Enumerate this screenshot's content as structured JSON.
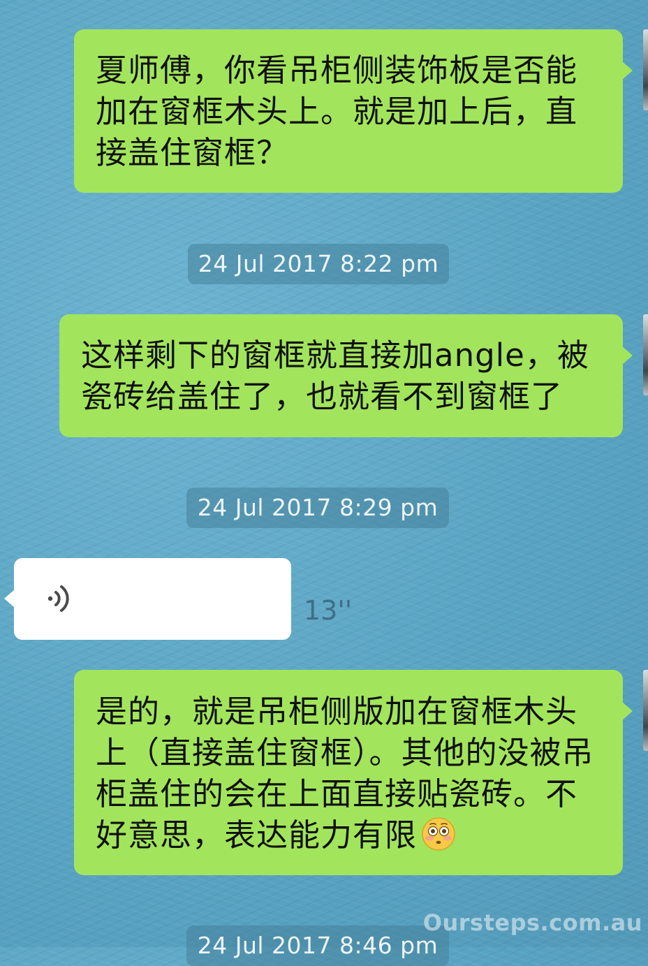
{
  "chat": {
    "messages": [
      {
        "type": "outgoing",
        "text": "夏师傅，你看吊柜侧装饰板是否能加在窗框木头上。就是加上后，直接盖住窗框？"
      },
      {
        "type": "timestamp",
        "text": "24 Jul 2017 8:22 pm"
      },
      {
        "type": "outgoing",
        "text": "这样剩下的窗框就直接加angle，被瓷砖给盖住了，也就看不到窗框了"
      },
      {
        "type": "timestamp",
        "text": "24 Jul 2017 8:29 pm"
      },
      {
        "type": "incoming-voice",
        "duration": "13''",
        "icon": "voice-wave-icon"
      },
      {
        "type": "outgoing",
        "text": "是的，就是吊柜侧版加在窗框木头上（直接盖住窗框）。其他的没被吊柜盖住的会在上面直接贴瓷砖。不好意思，表达能力有限",
        "emoji": "flushed-face"
      },
      {
        "type": "timestamp",
        "text": "24 Jul 2017 8:46 pm"
      }
    ]
  },
  "watermark": "Oursteps.com.au",
  "colors": {
    "outgoing_bubble": "#a2e55c",
    "incoming_bubble": "#ffffff",
    "background": "#5fa9c7",
    "timestamp_pill": "#46829b"
  }
}
